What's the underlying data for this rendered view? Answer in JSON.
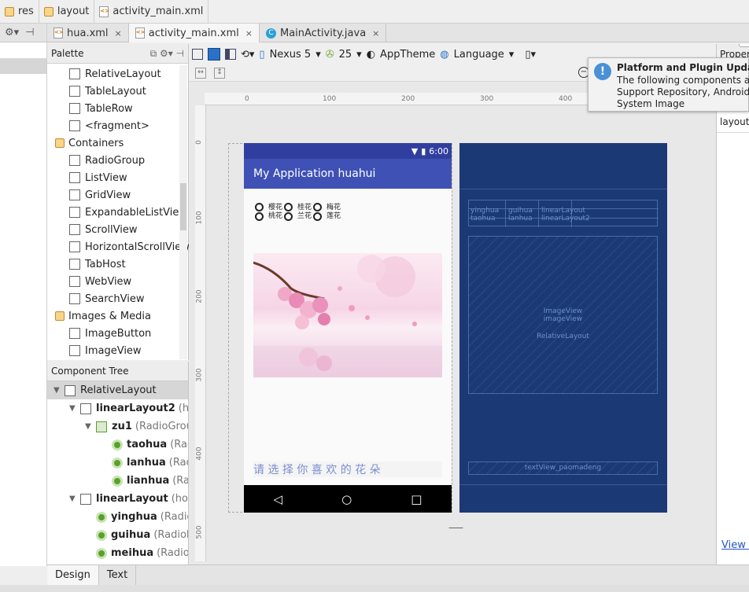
{
  "breadcrumb": [
    "res",
    "layout",
    "activity_main.xml"
  ],
  "tabs": [
    {
      "label": "hua.xml",
      "close": "×"
    },
    {
      "label": "activity_main.xml",
      "close": "×"
    },
    {
      "label": "MainActivity.java",
      "close": "×"
    }
  ],
  "palette": {
    "title": "Palette",
    "items": [
      {
        "label": "RelativeLayout",
        "kind": "widget"
      },
      {
        "label": "TableLayout",
        "kind": "widget"
      },
      {
        "label": "TableRow",
        "kind": "widget"
      },
      {
        "label": "<fragment>",
        "kind": "widget"
      },
      {
        "label": "Containers",
        "kind": "folder"
      },
      {
        "label": "RadioGroup",
        "kind": "widget"
      },
      {
        "label": "ListView",
        "kind": "widget"
      },
      {
        "label": "GridView",
        "kind": "widget"
      },
      {
        "label": "ExpandableListView",
        "kind": "widget"
      },
      {
        "label": "ScrollView",
        "kind": "widget"
      },
      {
        "label": "HorizontalScrollView",
        "kind": "widget"
      },
      {
        "label": "TabHost",
        "kind": "widget"
      },
      {
        "label": "WebView",
        "kind": "widget"
      },
      {
        "label": "SearchView",
        "kind": "widget"
      },
      {
        "label": "Images & Media",
        "kind": "folder"
      },
      {
        "label": "ImageButton",
        "kind": "widget"
      },
      {
        "label": "ImageView",
        "kind": "widget"
      }
    ]
  },
  "component_tree": {
    "title": "Component Tree",
    "items": [
      {
        "name": "RelativeLayout",
        "type": "",
        "indent": 0,
        "toggle": "▼",
        "icon": "layout"
      },
      {
        "name": "linearLayout2",
        "type": "(hor",
        "indent": 1,
        "toggle": "▼",
        "icon": "linear"
      },
      {
        "name": "zu1",
        "type": "(RadioGrou",
        "indent": 2,
        "toggle": "▼",
        "icon": "radiogroup"
      },
      {
        "name": "taohua",
        "type": "(Rac",
        "indent": 3,
        "toggle": "",
        "icon": "radio"
      },
      {
        "name": "lanhua",
        "type": "(Rac",
        "indent": 3,
        "toggle": "",
        "icon": "radio"
      },
      {
        "name": "lianhua",
        "type": "(Ra",
        "indent": 3,
        "toggle": "",
        "icon": "radio"
      },
      {
        "name": "linearLayout",
        "type": "(horiz",
        "indent": 1,
        "toggle": "▼",
        "icon": "linear"
      },
      {
        "name": "yinghua",
        "type": "(Radic",
        "indent": 2,
        "toggle": "",
        "icon": "radio"
      },
      {
        "name": "guihua",
        "type": "(RadioE",
        "indent": 2,
        "toggle": "",
        "icon": "radio"
      },
      {
        "name": "meihua",
        "type": "(Radiol",
        "indent": 2,
        "toggle": "",
        "icon": "radio"
      }
    ]
  },
  "toolbar": {
    "device": "Nexus 5",
    "api": "25",
    "theme": "AppTheme",
    "language": "Language"
  },
  "ruler": {
    "h": [
      "0",
      "100",
      "200",
      "300",
      "400"
    ],
    "v": [
      "0",
      "100",
      "200",
      "300",
      "400",
      "500"
    ]
  },
  "phone": {
    "time": "6:00",
    "app_title": "My Application huahui",
    "radio_rows": [
      {
        "top": "樱花",
        "bottom": "桃花"
      },
      {
        "top": "桂花",
        "bottom": "兰花"
      },
      {
        "top": "梅花",
        "bottom": "莲花"
      }
    ],
    "marquee": "请 选 择 你 喜 欢 的 花 朵"
  },
  "blueprint": {
    "row1": [
      "yinghua",
      "guihua",
      "linearLayout"
    ],
    "row2": [
      "taohua",
      "lanhua",
      "linearLayout2"
    ],
    "image_labels": [
      "ImageView",
      "imageView",
      "RelativeLayout"
    ],
    "text_label": "textView_paomadeng"
  },
  "properties": {
    "title": "Propert",
    "layout": "layout_",
    "link": "View a"
  },
  "notification": {
    "title": "Platform and Plugin Update",
    "lines": [
      "The following components are",
      "Support Repository, Android SI",
      "System Image"
    ]
  },
  "bottom_tabs": [
    "Design",
    "Text"
  ],
  "colors": {
    "accent": "#3f51b5",
    "blueprint": "#1b3a75",
    "marquee": "#7a8fd0"
  }
}
